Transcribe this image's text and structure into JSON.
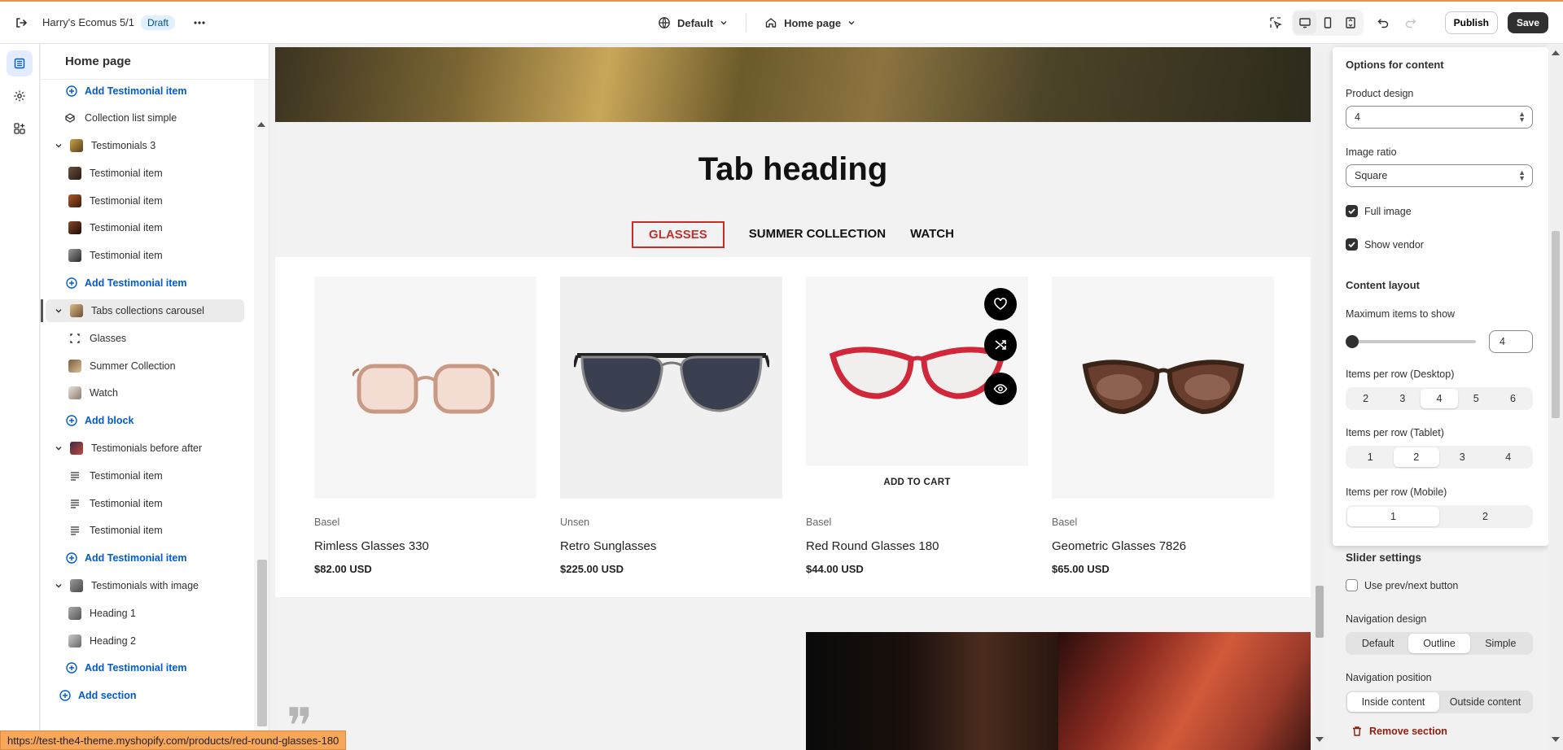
{
  "topbar": {
    "store_name": "Harry's Ecomus 5/1",
    "status_badge": "Draft",
    "theme_selector": "Default",
    "page_selector": "Home page",
    "publish_label": "Publish",
    "save_label": "Save"
  },
  "sidebar": {
    "title": "Home page",
    "items": [
      {
        "label": "Add Testimonial item",
        "kind": "add",
        "level": 2
      },
      {
        "label": "Collection list simple",
        "kind": "section",
        "level": 1
      },
      {
        "label": "Testimonials 3",
        "kind": "section",
        "level": 1
      },
      {
        "label": "Testimonial item",
        "kind": "block",
        "level": 2
      },
      {
        "label": "Testimonial item",
        "kind": "block",
        "level": 2
      },
      {
        "label": "Testimonial item",
        "kind": "block",
        "level": 2
      },
      {
        "label": "Testimonial item",
        "kind": "block",
        "level": 2
      },
      {
        "label": "Add Testimonial item",
        "kind": "add",
        "level": 2
      },
      {
        "label": "Tabs collections carousel",
        "kind": "section",
        "level": 1,
        "selected": true
      },
      {
        "label": "Glasses",
        "kind": "block",
        "level": 2
      },
      {
        "label": "Summer Collection",
        "kind": "block",
        "level": 2
      },
      {
        "label": "Watch",
        "kind": "block",
        "level": 2
      },
      {
        "label": "Add block",
        "kind": "add",
        "level": 2
      },
      {
        "label": "Testimonials before after",
        "kind": "section",
        "level": 1
      },
      {
        "label": "Testimonial item",
        "kind": "block",
        "level": 2
      },
      {
        "label": "Testimonial item",
        "kind": "block",
        "level": 2
      },
      {
        "label": "Testimonial item",
        "kind": "block",
        "level": 2
      },
      {
        "label": "Add Testimonial item",
        "kind": "add",
        "level": 2
      },
      {
        "label": "Testimonials with image",
        "kind": "section",
        "level": 1
      },
      {
        "label": "Heading 1",
        "kind": "block",
        "level": 2
      },
      {
        "label": "Heading 2",
        "kind": "block",
        "level": 2
      },
      {
        "label": "Add Testimonial item",
        "kind": "add",
        "level": 2
      },
      {
        "label": "Add section",
        "kind": "add-section",
        "level": 1
      }
    ]
  },
  "preview": {
    "tab_heading": "Tab heading",
    "tabs": [
      "GLASSES",
      "SUMMER COLLECTION",
      "WATCH"
    ],
    "active_tab": 0,
    "products": [
      {
        "vendor": "Basel",
        "name": "Rimless Glasses 330",
        "price": "$82.00 USD"
      },
      {
        "vendor": "Unsen",
        "name": "Retro Sunglasses",
        "price": "$225.00 USD"
      },
      {
        "vendor": "Basel",
        "name": "Red Round Glasses 180",
        "price": "$44.00 USD",
        "hovered": true
      },
      {
        "vendor": "Basel",
        "name": "Geometric Glasses 7826",
        "price": "$65.00 USD"
      }
    ],
    "add_to_cart": "ADD TO CART"
  },
  "settings": {
    "options_title": "Options for content",
    "product_design_label": "Product design",
    "product_design_value": "4",
    "image_ratio_label": "Image ratio",
    "image_ratio_value": "Square",
    "full_image_label": "Full image",
    "show_vendor_label": "Show vendor",
    "content_layout_title": "Content layout",
    "max_items_label": "Maximum items to show",
    "max_items_value": "4",
    "per_row_desktop_label": "Items per row (Desktop)",
    "per_row_desktop_options": [
      "2",
      "3",
      "4",
      "5",
      "6"
    ],
    "per_row_tablet_label": "Items per row (Tablet)",
    "per_row_tablet_options": [
      "1",
      "2",
      "3",
      "4"
    ],
    "per_row_mobile_label": "Items per row (Mobile)",
    "per_row_mobile_options": [
      "1",
      "2"
    ],
    "slider_settings_title": "Slider settings",
    "prev_next_label": "Use prev/next button",
    "nav_design_label": "Navigation design",
    "nav_design_options": [
      "Default",
      "Outline",
      "Simple"
    ],
    "nav_position_label": "Navigation position",
    "nav_position_options": [
      "Inside content",
      "Outside content"
    ],
    "remove_section_label": "Remove section"
  },
  "status_url": "https://test-the4-theme.myshopify.com/products/red-round-glasses-180",
  "colors": {
    "accent_tab": "#c0302c",
    "link": "#005bd3",
    "primary_button": "#303030",
    "danger": "#8e1f0b"
  }
}
